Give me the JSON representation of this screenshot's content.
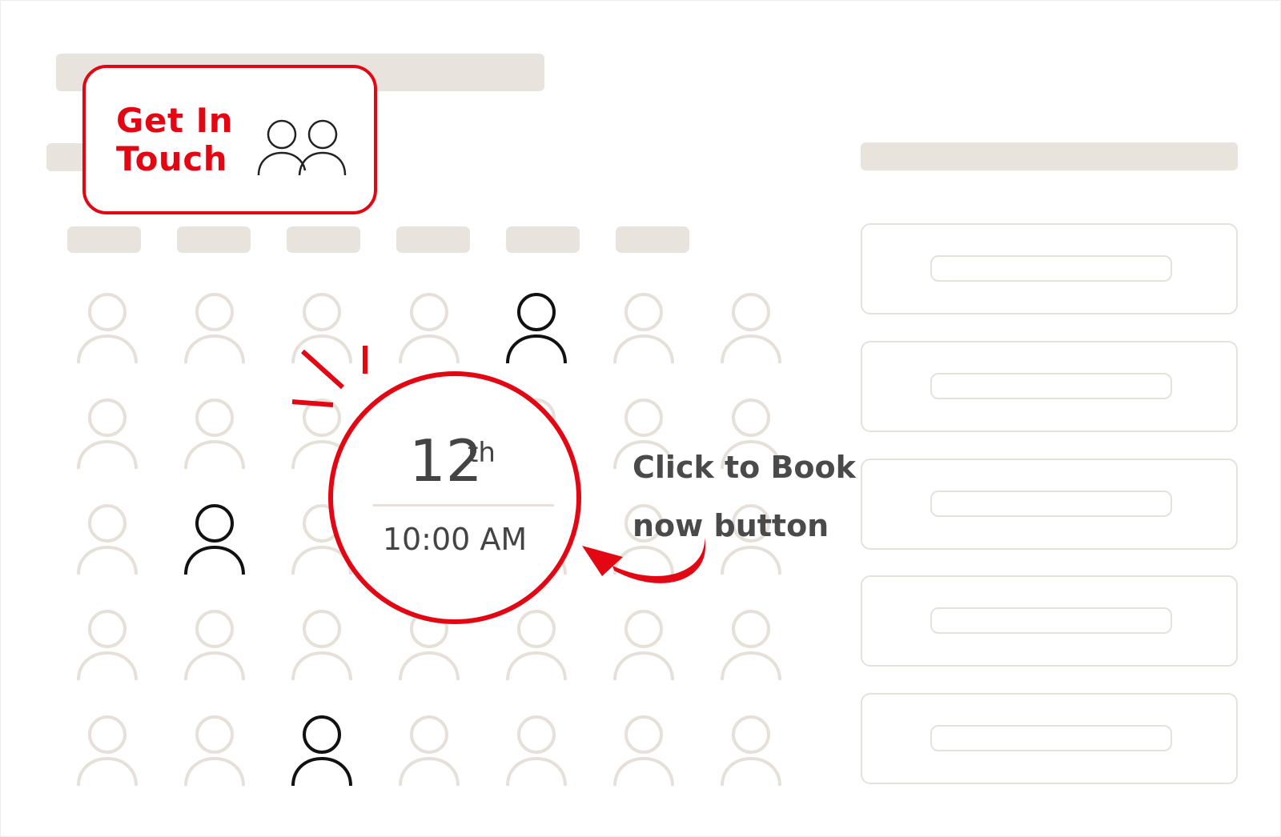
{
  "cta": {
    "line1": "Get In",
    "line2": "Touch",
    "icon": "people-icon"
  },
  "booking": {
    "day": "12",
    "day_suffix": "th",
    "time": "10:00 AM"
  },
  "annotation": {
    "line1": "Click to Book",
    "line2": "now button"
  },
  "colors": {
    "accent": "#e30613",
    "placeholder": "#e8e3dc",
    "muted_person": "#e6e0d8",
    "active_person": "#111111",
    "text": "#444444"
  }
}
